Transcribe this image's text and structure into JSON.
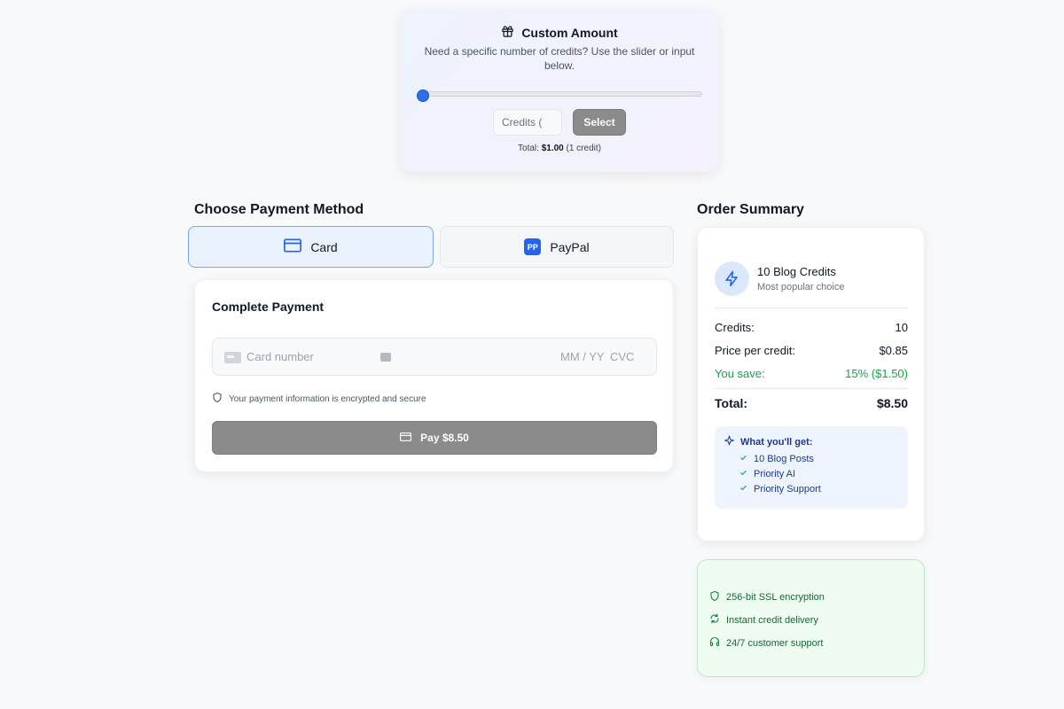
{
  "custom": {
    "title": "Custom Amount",
    "description": "Need a specific number of credits? Use the slider or input below.",
    "slider_value": 1,
    "input_placeholder": "Credits (",
    "select_label": "Select",
    "total_prefix": "Total:",
    "total_amount": "$1.00",
    "total_suffix": "(1 credit)",
    "icon": "gift-icon"
  },
  "payment": {
    "heading": "Choose Payment Method",
    "tabs": [
      {
        "label": "Card",
        "icon": "credit-card-icon",
        "active": true
      },
      {
        "label": "PayPal",
        "icon": "paypal-icon",
        "badge": "PP",
        "active": false
      }
    ],
    "card_title": "Complete Payment",
    "card_number_placeholder": "Card number",
    "expiry_placeholder": "MM / YY",
    "cvc_placeholder": "CVC",
    "secure_note": "Your payment information is encrypted and secure",
    "pay_label": "Pay $8.50"
  },
  "summary": {
    "heading": "Order Summary",
    "plan_name": "10 Blog Credits",
    "plan_subtitle": "Most popular choice",
    "rows": [
      {
        "label": "Credits:",
        "value": "10"
      },
      {
        "label": "Price per credit:",
        "value": "$0.85"
      },
      {
        "label": "You save:",
        "value": "15% ($1.50)"
      }
    ],
    "total_label": "Total:",
    "total_value": "$8.50",
    "benefits_heading": "What you'll get:",
    "benefits": [
      "10 Blog Posts",
      "Priority AI",
      "Priority Support"
    ]
  },
  "trust": [
    {
      "label": "256-bit SSL encryption",
      "icon": "shield-icon"
    },
    {
      "label": "Instant credit delivery",
      "icon": "refresh-icon"
    },
    {
      "label": "24/7 customer support",
      "icon": "headset-icon"
    }
  ],
  "colors": {
    "accent": "#2563eb",
    "success": "#16a34a",
    "disabled_button": "#8b8b8b",
    "background": "#f8f9fb"
  }
}
